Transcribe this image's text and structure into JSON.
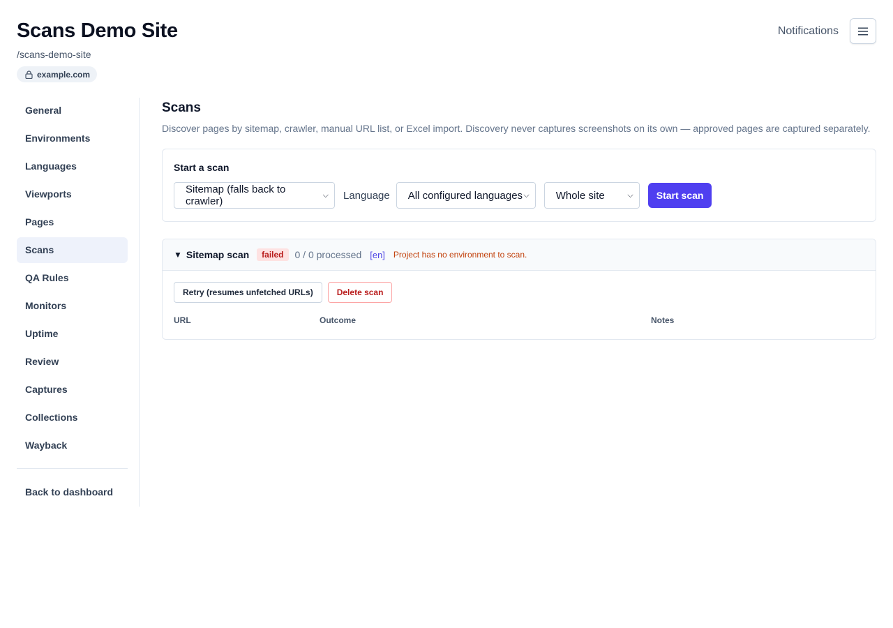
{
  "header": {
    "title": "Scans Demo Site",
    "slug": "/scans-demo-site",
    "domain": "example.com",
    "domain_icon": "lock-icon"
  },
  "top_nav": {
    "notifications_label": "Notifications",
    "menu_icon": "hamburger-menu-icon"
  },
  "sidebar": {
    "items": [
      {
        "label": "General"
      },
      {
        "label": "Environments"
      },
      {
        "label": "Languages"
      },
      {
        "label": "Viewports"
      },
      {
        "label": "Pages"
      },
      {
        "label": "Scans",
        "active": true
      },
      {
        "label": "QA Rules"
      },
      {
        "label": "Monitors"
      },
      {
        "label": "Uptime"
      },
      {
        "label": "Review"
      },
      {
        "label": "Captures"
      },
      {
        "label": "Collections"
      },
      {
        "label": "Wayback"
      }
    ],
    "back_label": "Back to dashboard"
  },
  "main": {
    "heading": "Scans",
    "description": "Discover pages by sitemap, crawler, manual URL list, or Excel import. Discovery never captures screenshots on its own — approved pages are captured separately.",
    "start_scan": {
      "title": "Start a scan",
      "method_selected": "Sitemap (falls back to crawler)",
      "language_label": "Language",
      "language_selected": "All configured languages",
      "scope_selected": "Whole site",
      "submit_label": "Start scan"
    },
    "scan": {
      "name": "Sitemap scan",
      "status": "failed",
      "processed": "0 / 0 processed",
      "language": "[en]",
      "error": "Project has no environment to scan.",
      "retry_label": "Retry (resumes unfetched URLs)",
      "delete_label": "Delete scan",
      "columns": [
        "URL",
        "Outcome",
        "Notes"
      ]
    }
  },
  "colors": {
    "accent": "#4f3ff0",
    "failed_bg": "#fee2e2",
    "failed_text": "#b91c1c",
    "error_text": "#c2410c"
  }
}
